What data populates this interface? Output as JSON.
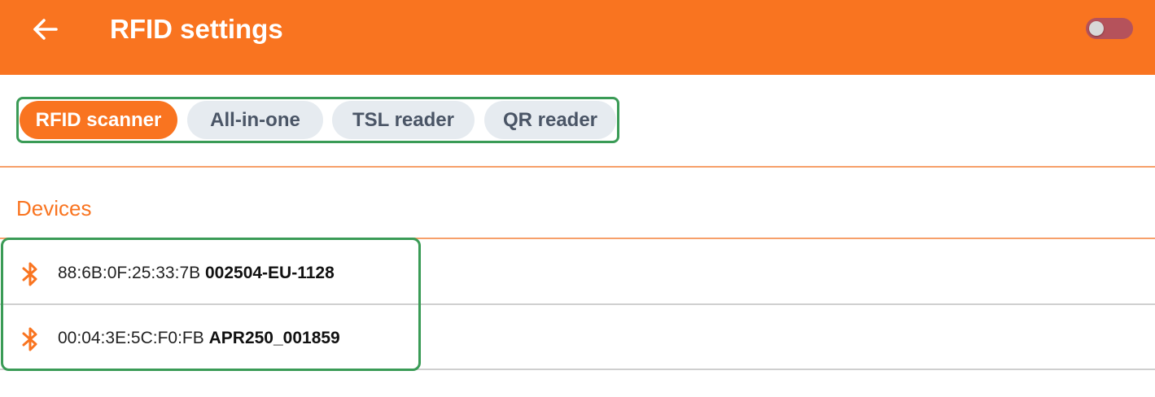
{
  "appbar": {
    "title": "RFID settings",
    "back_icon": "arrow-left-icon",
    "toggle_state": "off",
    "color": "#f97420"
  },
  "tabs": [
    {
      "label": "RFID scanner",
      "active": true
    },
    {
      "label": "All-in-one",
      "active": false
    },
    {
      "label": "TSL reader",
      "active": false
    },
    {
      "label": "QR reader",
      "active": false
    }
  ],
  "devices": {
    "section_label": "Devices",
    "items": [
      {
        "icon": "bluetooth-icon",
        "address": "88:6B:0F:25:33:7B",
        "name": "002504-EU-1128"
      },
      {
        "icon": "bluetooth-icon",
        "address": "00:04:3E:5C:F0:FB",
        "name": "APR250_001859"
      }
    ]
  }
}
